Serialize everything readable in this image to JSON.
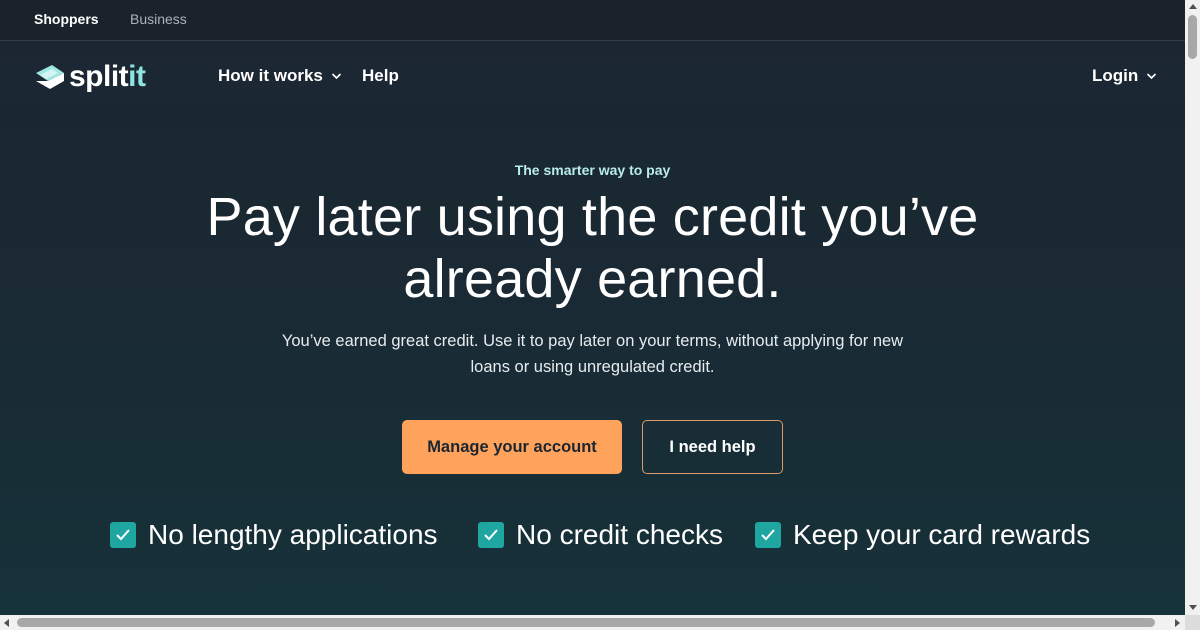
{
  "audience_bar": {
    "shoppers": "Shoppers",
    "business": "Business"
  },
  "nav": {
    "logo_icon": "splitit-logo-icon",
    "logo_text_main": "splitit",
    "how_it_works": "How it works",
    "help": "Help",
    "login": "Login",
    "dropdown_icon": "chevron-down-icon"
  },
  "hero": {
    "eyebrow": "The smarter way to pay",
    "headline": "Pay later using the credit you’ve already earned.",
    "subtext": "You’ve earned great credit. Use it to pay later on your terms, without applying for new loans or using unregulated credit.",
    "primary_button": "Manage your account",
    "secondary_button": "I need help"
  },
  "benefits": [
    {
      "label": "No lengthy applications",
      "icon": "check-icon"
    },
    {
      "label": "No credit checks",
      "icon": "check-icon"
    },
    {
      "label": "Keep your card rewards",
      "icon": "check-icon"
    }
  ],
  "colors": {
    "accent_orange": "#ffa35c",
    "teal_check": "#1fa6a0",
    "eyebrow_teal": "#b8ecea",
    "background_dark": "#1b2631"
  }
}
